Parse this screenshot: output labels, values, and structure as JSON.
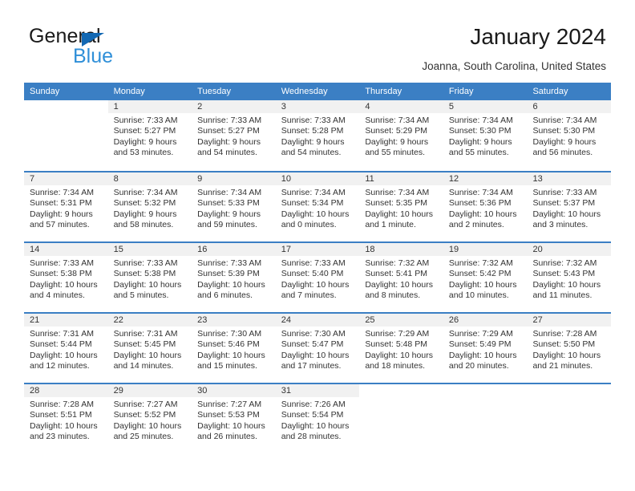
{
  "brand": {
    "name_dark": "General",
    "name_light": "Blue",
    "logo_icon": "triangle-icon",
    "accent_dark": "#1268b3",
    "accent_light": "#2f8fd8"
  },
  "header": {
    "title": "January 2024",
    "subtitle": "Joanna, South Carolina, United States"
  },
  "calendar": {
    "header_bg": "#3b7fc4",
    "header_text": "#ffffff",
    "daynum_bg": "#f1f1f1",
    "weekdays": [
      "Sunday",
      "Monday",
      "Tuesday",
      "Wednesday",
      "Thursday",
      "Friday",
      "Saturday"
    ],
    "weeks": [
      [
        {
          "day": "",
          "sunrise": "",
          "sunset": "",
          "daylight": ""
        },
        {
          "day": "1",
          "sunrise": "Sunrise: 7:33 AM",
          "sunset": "Sunset: 5:27 PM",
          "daylight": "Daylight: 9 hours and 53 minutes."
        },
        {
          "day": "2",
          "sunrise": "Sunrise: 7:33 AM",
          "sunset": "Sunset: 5:27 PM",
          "daylight": "Daylight: 9 hours and 54 minutes."
        },
        {
          "day": "3",
          "sunrise": "Sunrise: 7:33 AM",
          "sunset": "Sunset: 5:28 PM",
          "daylight": "Daylight: 9 hours and 54 minutes."
        },
        {
          "day": "4",
          "sunrise": "Sunrise: 7:34 AM",
          "sunset": "Sunset: 5:29 PM",
          "daylight": "Daylight: 9 hours and 55 minutes."
        },
        {
          "day": "5",
          "sunrise": "Sunrise: 7:34 AM",
          "sunset": "Sunset: 5:30 PM",
          "daylight": "Daylight: 9 hours and 55 minutes."
        },
        {
          "day": "6",
          "sunrise": "Sunrise: 7:34 AM",
          "sunset": "Sunset: 5:30 PM",
          "daylight": "Daylight: 9 hours and 56 minutes."
        }
      ],
      [
        {
          "day": "7",
          "sunrise": "Sunrise: 7:34 AM",
          "sunset": "Sunset: 5:31 PM",
          "daylight": "Daylight: 9 hours and 57 minutes."
        },
        {
          "day": "8",
          "sunrise": "Sunrise: 7:34 AM",
          "sunset": "Sunset: 5:32 PM",
          "daylight": "Daylight: 9 hours and 58 minutes."
        },
        {
          "day": "9",
          "sunrise": "Sunrise: 7:34 AM",
          "sunset": "Sunset: 5:33 PM",
          "daylight": "Daylight: 9 hours and 59 minutes."
        },
        {
          "day": "10",
          "sunrise": "Sunrise: 7:34 AM",
          "sunset": "Sunset: 5:34 PM",
          "daylight": "Daylight: 10 hours and 0 minutes."
        },
        {
          "day": "11",
          "sunrise": "Sunrise: 7:34 AM",
          "sunset": "Sunset: 5:35 PM",
          "daylight": "Daylight: 10 hours and 1 minute."
        },
        {
          "day": "12",
          "sunrise": "Sunrise: 7:34 AM",
          "sunset": "Sunset: 5:36 PM",
          "daylight": "Daylight: 10 hours and 2 minutes."
        },
        {
          "day": "13",
          "sunrise": "Sunrise: 7:33 AM",
          "sunset": "Sunset: 5:37 PM",
          "daylight": "Daylight: 10 hours and 3 minutes."
        }
      ],
      [
        {
          "day": "14",
          "sunrise": "Sunrise: 7:33 AM",
          "sunset": "Sunset: 5:38 PM",
          "daylight": "Daylight: 10 hours and 4 minutes."
        },
        {
          "day": "15",
          "sunrise": "Sunrise: 7:33 AM",
          "sunset": "Sunset: 5:38 PM",
          "daylight": "Daylight: 10 hours and 5 minutes."
        },
        {
          "day": "16",
          "sunrise": "Sunrise: 7:33 AM",
          "sunset": "Sunset: 5:39 PM",
          "daylight": "Daylight: 10 hours and 6 minutes."
        },
        {
          "day": "17",
          "sunrise": "Sunrise: 7:33 AM",
          "sunset": "Sunset: 5:40 PM",
          "daylight": "Daylight: 10 hours and 7 minutes."
        },
        {
          "day": "18",
          "sunrise": "Sunrise: 7:32 AM",
          "sunset": "Sunset: 5:41 PM",
          "daylight": "Daylight: 10 hours and 8 minutes."
        },
        {
          "day": "19",
          "sunrise": "Sunrise: 7:32 AM",
          "sunset": "Sunset: 5:42 PM",
          "daylight": "Daylight: 10 hours and 10 minutes."
        },
        {
          "day": "20",
          "sunrise": "Sunrise: 7:32 AM",
          "sunset": "Sunset: 5:43 PM",
          "daylight": "Daylight: 10 hours and 11 minutes."
        }
      ],
      [
        {
          "day": "21",
          "sunrise": "Sunrise: 7:31 AM",
          "sunset": "Sunset: 5:44 PM",
          "daylight": "Daylight: 10 hours and 12 minutes."
        },
        {
          "day": "22",
          "sunrise": "Sunrise: 7:31 AM",
          "sunset": "Sunset: 5:45 PM",
          "daylight": "Daylight: 10 hours and 14 minutes."
        },
        {
          "day": "23",
          "sunrise": "Sunrise: 7:30 AM",
          "sunset": "Sunset: 5:46 PM",
          "daylight": "Daylight: 10 hours and 15 minutes."
        },
        {
          "day": "24",
          "sunrise": "Sunrise: 7:30 AM",
          "sunset": "Sunset: 5:47 PM",
          "daylight": "Daylight: 10 hours and 17 minutes."
        },
        {
          "day": "25",
          "sunrise": "Sunrise: 7:29 AM",
          "sunset": "Sunset: 5:48 PM",
          "daylight": "Daylight: 10 hours and 18 minutes."
        },
        {
          "day": "26",
          "sunrise": "Sunrise: 7:29 AM",
          "sunset": "Sunset: 5:49 PM",
          "daylight": "Daylight: 10 hours and 20 minutes."
        },
        {
          "day": "27",
          "sunrise": "Sunrise: 7:28 AM",
          "sunset": "Sunset: 5:50 PM",
          "daylight": "Daylight: 10 hours and 21 minutes."
        }
      ],
      [
        {
          "day": "28",
          "sunrise": "Sunrise: 7:28 AM",
          "sunset": "Sunset: 5:51 PM",
          "daylight": "Daylight: 10 hours and 23 minutes."
        },
        {
          "day": "29",
          "sunrise": "Sunrise: 7:27 AM",
          "sunset": "Sunset: 5:52 PM",
          "daylight": "Daylight: 10 hours and 25 minutes."
        },
        {
          "day": "30",
          "sunrise": "Sunrise: 7:27 AM",
          "sunset": "Sunset: 5:53 PM",
          "daylight": "Daylight: 10 hours and 26 minutes."
        },
        {
          "day": "31",
          "sunrise": "Sunrise: 7:26 AM",
          "sunset": "Sunset: 5:54 PM",
          "daylight": "Daylight: 10 hours and 28 minutes."
        },
        {
          "day": "",
          "sunrise": "",
          "sunset": "",
          "daylight": ""
        },
        {
          "day": "",
          "sunrise": "",
          "sunset": "",
          "daylight": ""
        },
        {
          "day": "",
          "sunrise": "",
          "sunset": "",
          "daylight": ""
        }
      ]
    ]
  }
}
